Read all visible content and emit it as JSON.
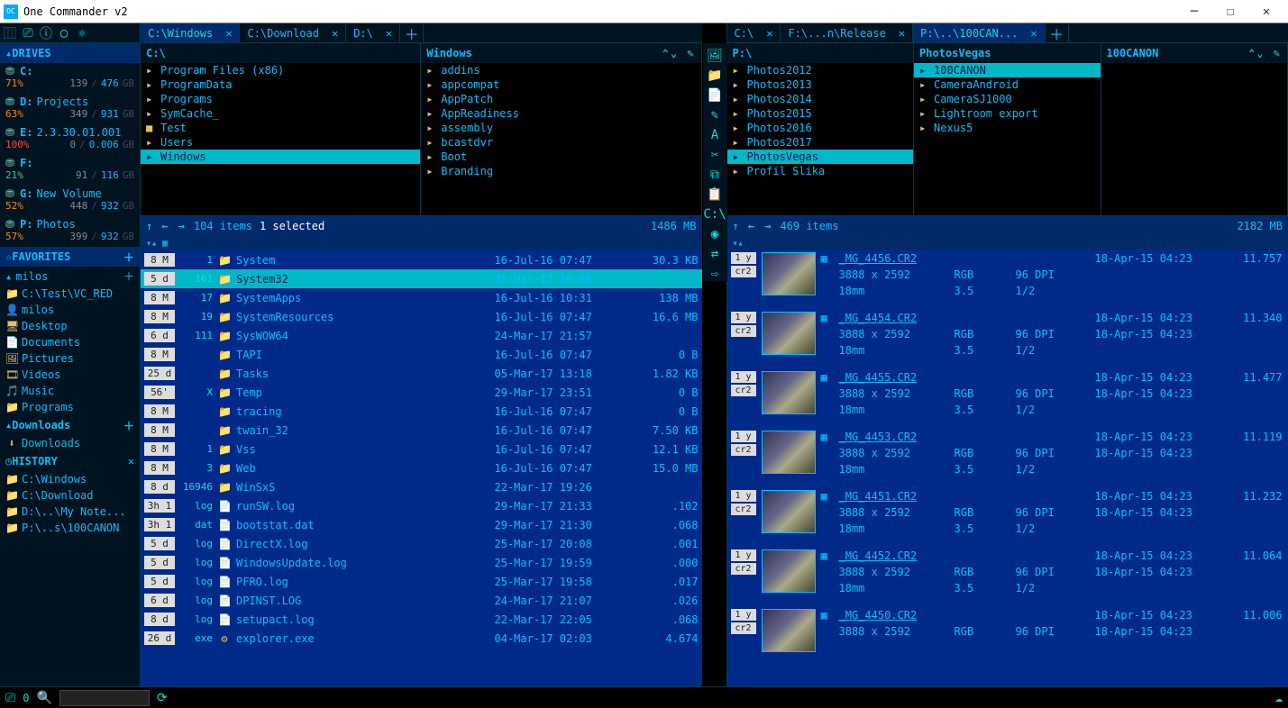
{
  "window": {
    "title": "One Commander v2"
  },
  "sidebar": {
    "drives_hd": "DRIVES",
    "drives": [
      {
        "letter": "C:",
        "label": "",
        "pct": "71%",
        "pct_cls": "orange",
        "used": "139",
        "total": "476",
        "unit": "GB"
      },
      {
        "letter": "D:",
        "label": "Projects",
        "pct": "63%",
        "pct_cls": "orange",
        "used": "349",
        "total": "931",
        "unit": "GB"
      },
      {
        "letter": "E:",
        "label": "2.3.30.01.001",
        "pct": "100%",
        "pct_cls": "red",
        "used": "0",
        "total": "0.006",
        "unit": "GB"
      },
      {
        "letter": "F:",
        "label": "",
        "pct": "21%",
        "pct_cls": "green",
        "used": "91",
        "total": "116",
        "unit": "GB"
      },
      {
        "letter": "G:",
        "label": "New Volume",
        "pct": "52%",
        "pct_cls": "orange",
        "used": "448",
        "total": "932",
        "unit": "GB"
      },
      {
        "letter": "P:",
        "label": "Photos",
        "pct": "57%",
        "pct_cls": "orange",
        "used": "399",
        "total": "932",
        "unit": "GB"
      }
    ],
    "fav_hd": "FAVORITES",
    "favgrp": "milos",
    "favs": [
      {
        "icon": "📁",
        "label": "C:\\Test\\VC_RED"
      },
      {
        "icon": "👤",
        "label": "milos"
      },
      {
        "icon": "🖥",
        "label": "Desktop"
      },
      {
        "icon": "📄",
        "label": "Documents"
      },
      {
        "icon": "🖼",
        "label": "Pictures"
      },
      {
        "icon": "🎞",
        "label": "Videos"
      },
      {
        "icon": "🎵",
        "label": "Music"
      },
      {
        "icon": "📁",
        "label": "Programs"
      }
    ],
    "dl_hd": "Downloads",
    "dl_item": "Downloads",
    "hist_hd": "HISTORY",
    "hist": [
      "C:\\Windows",
      "C:\\Download",
      "D:\\..\\My Note...",
      "P:\\..s\\100CANON"
    ]
  },
  "left": {
    "tabs": [
      {
        "label": "C:\\Windows",
        "active": true
      },
      {
        "label": "C:\\Download",
        "active": false
      },
      {
        "label": "D:\\",
        "active": false
      }
    ],
    "cols": [
      {
        "hd": "C:\\",
        "items": [
          {
            "n": "Program Files (x86)"
          },
          {
            "n": "ProgramData"
          },
          {
            "n": "Programs"
          },
          {
            "n": "SymCache_"
          },
          {
            "n": "Test",
            "red": true
          },
          {
            "n": "Users"
          },
          {
            "n": "Windows",
            "sel": true
          }
        ]
      },
      {
        "hd": "Windows",
        "arrows": true,
        "items": [
          {
            "n": "addins"
          },
          {
            "n": "appcompat"
          },
          {
            "n": "AppPatch"
          },
          {
            "n": "AppReadiness"
          },
          {
            "n": "assembly"
          },
          {
            "n": "bcastdvr"
          },
          {
            "n": "Boot"
          },
          {
            "n": "Branding"
          }
        ]
      }
    ],
    "status": {
      "items": "104 items",
      "sel": "1 selected",
      "size": "1486 MB"
    },
    "rows": [
      {
        "age": "8 M",
        "cnt": "1",
        "ico": "📁",
        "nm": "System",
        "dt": "16-Jul-16  07:47",
        "sz": "30.3 KB"
      },
      {
        "age": "5 d",
        "cnt": "161",
        "ico": "📁",
        "nm": "System32",
        "dt": "25-Mar-17  20:08",
        "sz": "",
        "sel": true
      },
      {
        "age": "8 M",
        "cnt": "17",
        "ico": "📁",
        "nm": "SystemApps",
        "dt": "16-Jul-16  10:31",
        "sz": "138 MB"
      },
      {
        "age": "8 M",
        "cnt": "19",
        "ico": "📁",
        "nm": "SystemResources",
        "dt": "16-Jul-16  07:47",
        "sz": "16.6 MB"
      },
      {
        "age": "6 d",
        "cnt": "111",
        "ico": "📁",
        "nm": "SysWOW64",
        "dt": "24-Mar-17  21:57",
        "sz": ""
      },
      {
        "age": "8 M",
        "cnt": "",
        "ico": "📁",
        "nm": "TAPI",
        "dt": "16-Jul-16  07:47",
        "sz": "0 B"
      },
      {
        "age": "25 d",
        "cnt": "",
        "ico": "📁",
        "nm": "Tasks",
        "dt": "05-Mar-17  13:18",
        "sz": "1.82 KB"
      },
      {
        "age": "56'",
        "cnt": "X",
        "ico": "📁",
        "nm": "Temp",
        "dt": "29-Mar-17  23:51",
        "sz": "0 B"
      },
      {
        "age": "8 M",
        "cnt": "",
        "ico": "📁",
        "nm": "tracing",
        "dt": "16-Jul-16  07:47",
        "sz": "0 B"
      },
      {
        "age": "8 M",
        "cnt": "",
        "ico": "📁",
        "nm": "twain_32",
        "dt": "16-Jul-16  07:47",
        "sz": "7.50 KB"
      },
      {
        "age": "8 M",
        "cnt": "1",
        "ico": "📁",
        "nm": "Vss",
        "dt": "16-Jul-16  07:47",
        "sz": "12.1 KB"
      },
      {
        "age": "8 M",
        "cnt": "3",
        "ico": "📁",
        "nm": "Web",
        "dt": "16-Jul-16  07:47",
        "sz": "15.0 MB"
      },
      {
        "age": "8 d",
        "cnt": "16946",
        "ico": "📁",
        "nm": "WinSxS",
        "dt": "22-Mar-17  19:26",
        "sz": ""
      },
      {
        "age": "3h 1",
        "cnt": "log",
        "ico": "📄",
        "nm": "runSW.log",
        "dt": "29-Mar-17  21:33",
        "sz": ".102"
      },
      {
        "age": "3h 1",
        "cnt": "dat",
        "ico": "📄",
        "nm": "bootstat.dat",
        "dt": "29-Mar-17  21:30",
        "sz": ".068"
      },
      {
        "age": "5 d",
        "cnt": "log",
        "ico": "📄",
        "nm": "DirectX.log",
        "dt": "25-Mar-17  20:08",
        "sz": ".001"
      },
      {
        "age": "5 d",
        "cnt": "log",
        "ico": "📄",
        "nm": "WindowsUpdate.log",
        "dt": "25-Mar-17  19:59",
        "sz": ".000"
      },
      {
        "age": "5 d",
        "cnt": "log",
        "ico": "📄",
        "nm": "PFRO.log",
        "dt": "25-Mar-17  19:58",
        "sz": ".017"
      },
      {
        "age": "6 d",
        "cnt": "log",
        "ico": "📄",
        "nm": "DPINST.LOG",
        "dt": "24-Mar-17  21:07",
        "sz": ".026"
      },
      {
        "age": "8 d",
        "cnt": "log",
        "ico": "📄",
        "nm": "setupact.log",
        "dt": "22-Mar-17  22:05",
        "sz": ".068"
      },
      {
        "age": "26 d",
        "cnt": "exe",
        "ico": "⚙",
        "nm": "explorer.exe",
        "dt": "04-Mar-17  02:03",
        "sz": "4.674"
      }
    ]
  },
  "right": {
    "tabs": [
      {
        "label": "C:\\",
        "active": false
      },
      {
        "label": "F:\\...n\\Release",
        "active": false
      },
      {
        "label": "P:\\..\\100CAN...",
        "active": true
      }
    ],
    "cols": [
      {
        "hd": "P:\\",
        "items": [
          {
            "n": "Photos2012"
          },
          {
            "n": "Photos2013"
          },
          {
            "n": "Photos2014"
          },
          {
            "n": "Photos2015"
          },
          {
            "n": "Photos2016"
          },
          {
            "n": "Photos2017"
          },
          {
            "n": "PhotosVegas",
            "sel": true
          },
          {
            "n": "Profil Slika"
          }
        ]
      },
      {
        "hd": "PhotosVegas",
        "items": [
          {
            "n": "100CANON",
            "sel": true
          },
          {
            "n": "CameraAndroid"
          },
          {
            "n": "CameraSJ1000"
          },
          {
            "n": "Lightroom export"
          },
          {
            "n": "Nexus5"
          }
        ]
      },
      {
        "hd": "100CANON",
        "arrows": true,
        "items": []
      }
    ],
    "status": {
      "items": "469 items",
      "sel": "",
      "size": "2182 MB"
    },
    "photos": [
      {
        "age": "1 y",
        "ext": "cr2",
        "fn": "_MG_4456.CR2",
        "dim": "3888 x 2592",
        "cs": "RGB",
        "dpi": "96 DPI",
        "dt": "18-Apr-15  04:23",
        "sz": "11.757",
        "lens": "18mm",
        "ap": "3.5",
        "sh": "1/2"
      },
      {
        "age": "1 y",
        "ext": "cr2",
        "fn": "_MG_4454.CR2",
        "dim": "3888 x 2592",
        "cs": "RGB",
        "dpi": "96 DPI",
        "dt": "18-Apr-15  04:23",
        "sz": "11.340",
        "lens": "18mm",
        "ap": "3.5",
        "sh": "1/2",
        "dt2": "18-Apr-15  04:23"
      },
      {
        "age": "1 y",
        "ext": "cr2",
        "fn": "_MG_4455.CR2",
        "dim": "3888 x 2592",
        "cs": "RGB",
        "dpi": "96 DPI",
        "dt": "18-Apr-15  04:23",
        "sz": "11.477",
        "lens": "18mm",
        "ap": "3.5",
        "sh": "1/2",
        "dt2": "18-Apr-15  04:23"
      },
      {
        "age": "1 y",
        "ext": "cr2",
        "fn": "_MG_4453.CR2",
        "dim": "3888 x 2592",
        "cs": "RGB",
        "dpi": "96 DPI",
        "dt": "18-Apr-15  04:23",
        "sz": "11.119",
        "lens": "18mm",
        "ap": "3.5",
        "sh": "1/2",
        "dt2": "18-Apr-15  04:23"
      },
      {
        "age": "1 y",
        "ext": "cr2",
        "fn": "_MG_4451.CR2",
        "dim": "3888 x 2592",
        "cs": "RGB",
        "dpi": "96 DPI",
        "dt": "18-Apr-15  04:23",
        "sz": "11.232",
        "lens": "18mm",
        "ap": "3.5",
        "sh": "1/2",
        "dt2": "18-Apr-15  04:23"
      },
      {
        "age": "1 y",
        "ext": "cr2",
        "fn": "_MG_4452.CR2",
        "dim": "3888 x 2592",
        "cs": "RGB",
        "dpi": "96 DPI",
        "dt": "18-Apr-15  04:23",
        "sz": "11.064",
        "lens": "18mm",
        "ap": "3.5",
        "sh": "1/2",
        "dt2": "18-Apr-15  04:23"
      },
      {
        "age": "1 y",
        "ext": "cr2",
        "fn": "_MG_4450.CR2",
        "dim": "3888 x 2592",
        "cs": "RGB",
        "dpi": "96 DPI",
        "dt": "18-Apr-15  04:23",
        "sz": "11.006",
        "lens": "",
        "ap": "",
        "sh": "",
        "dt2": "18-Apr-15  04:23"
      }
    ]
  },
  "bottom": {
    "count": "0"
  }
}
